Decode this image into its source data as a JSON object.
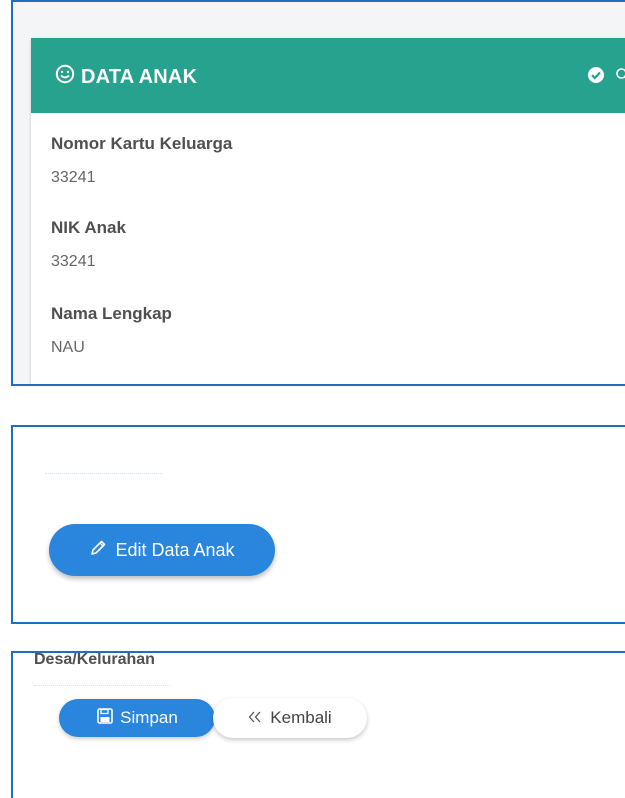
{
  "card": {
    "title": "DATA ANAK",
    "header_color": "#26a28f",
    "icons": [
      "smile-icon",
      "check-circle-icon",
      "search-icon"
    ]
  },
  "fields": [
    {
      "label": "Nomor Kartu Keluarga",
      "value": "33241"
    },
    {
      "label": "NIK Anak",
      "value": "33241"
    },
    {
      "label": "Nama Lengkap",
      "value": "NAU"
    }
  ],
  "edit_button": {
    "label": "Edit Data Anak",
    "icon": "pencil-icon",
    "color": "#2a86dd"
  },
  "desa": {
    "label": "Desa/Kelurahan"
  },
  "actions": {
    "save_label": "Simpan",
    "save_icon": "floppy-disk-icon",
    "back_label": "Kembali",
    "back_icon": "double-chevron-left-icon"
  }
}
